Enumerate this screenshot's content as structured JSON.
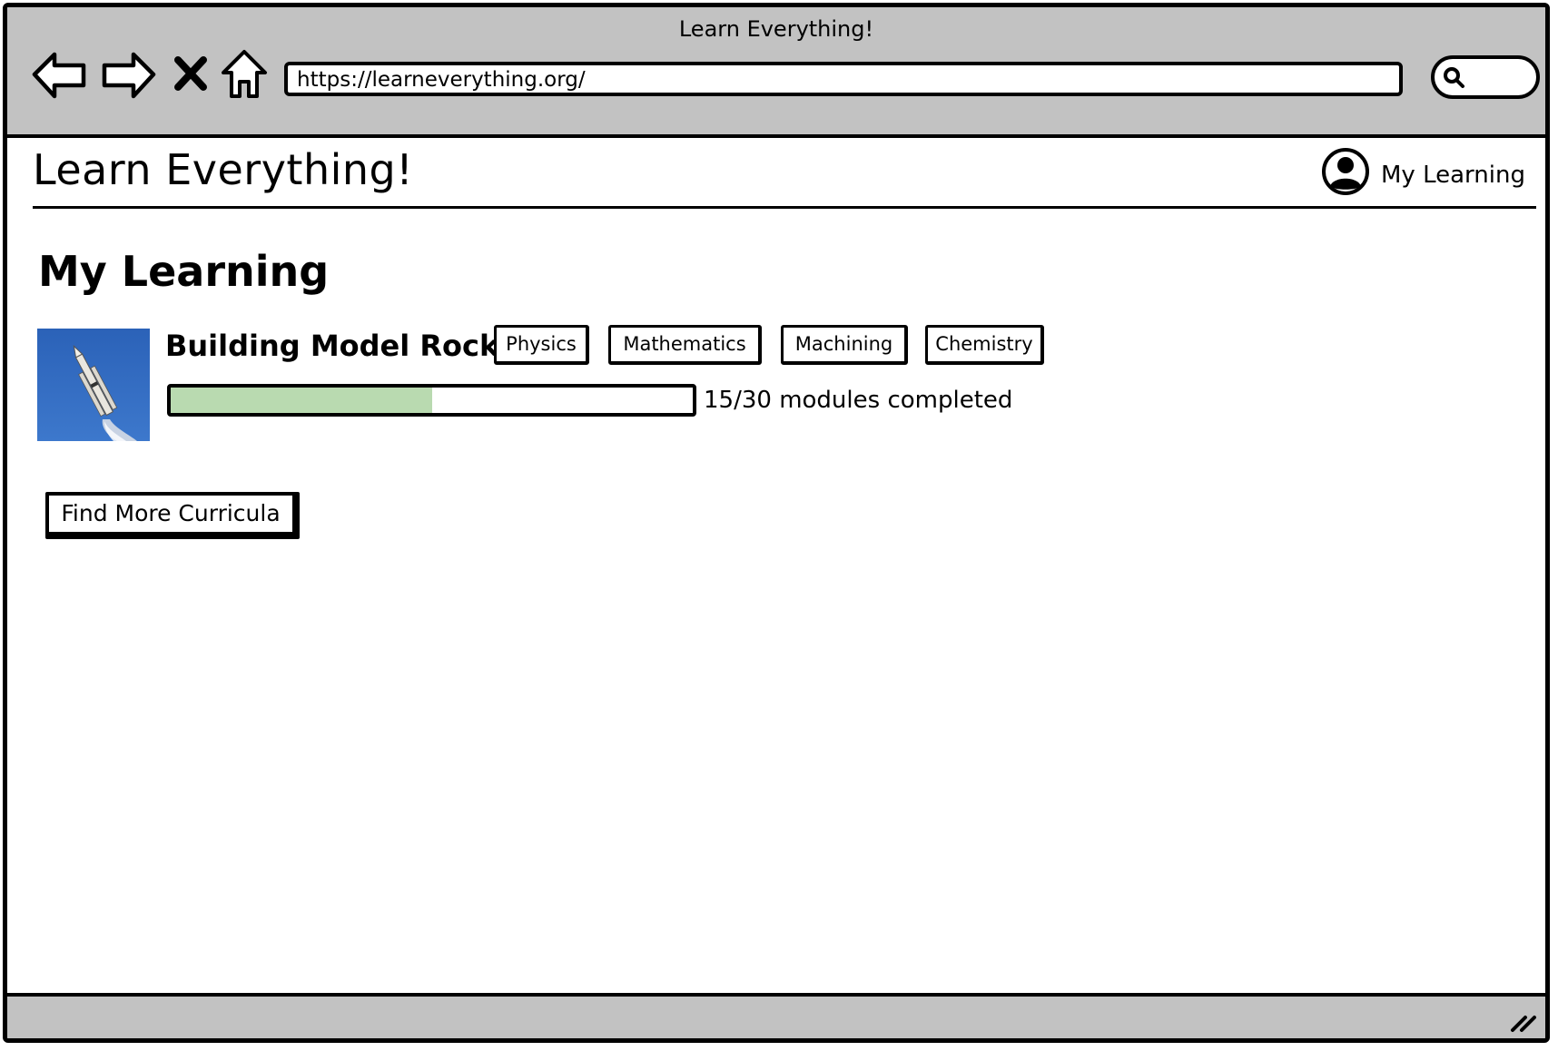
{
  "window": {
    "title": "Learn Everything!"
  },
  "browser": {
    "url": "https://learneverything.org/",
    "icons": [
      "back-arrow-icon",
      "forward-arrow-icon",
      "close-x-icon",
      "home-icon",
      "search-icon"
    ]
  },
  "site": {
    "logo": "Learn Everything!",
    "user_link": "My Learning",
    "user_icon": "user-avatar-icon"
  },
  "main": {
    "title": "My Learning",
    "courses": [
      {
        "title": "Building Model Rockets",
        "thumbnail_icon": "rocket-launch-image",
        "tags": [
          "Physics",
          "Mathematics",
          "Machining",
          "Chemistry"
        ],
        "progress": {
          "completed": 15,
          "total": 30,
          "label": "15/30 modules completed"
        }
      }
    ],
    "find_more_label": "Find More Curricula"
  },
  "colors": {
    "chrome": "#c2c2c2",
    "progress_fill": "#b9dab0",
    "thumbnail_sky": "#2f68be"
  }
}
